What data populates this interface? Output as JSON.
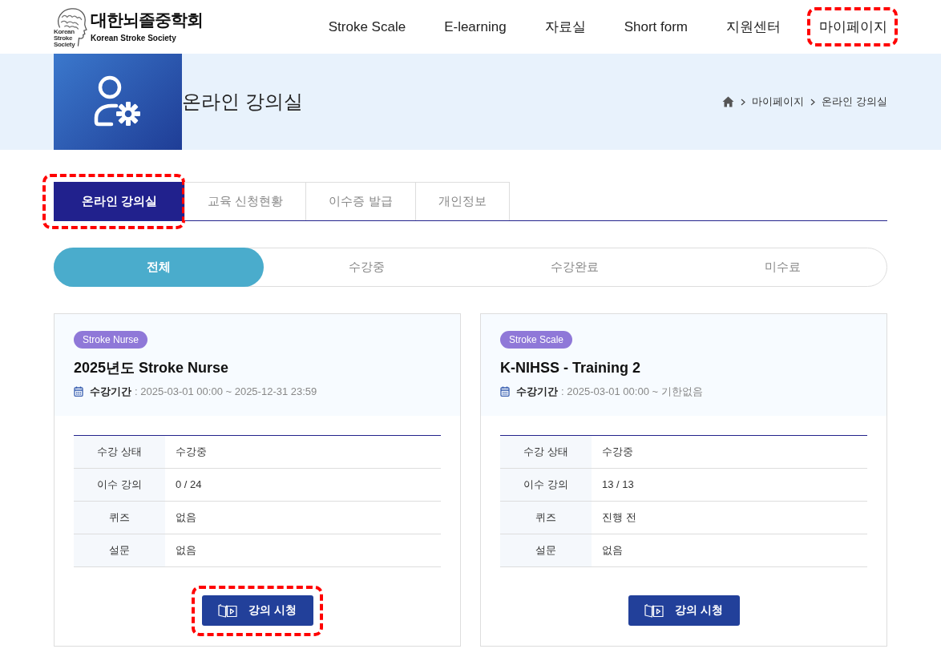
{
  "header": {
    "logo": {
      "name_ko": "대한뇌졸중학회",
      "name_en": "Korean Stroke Society",
      "emblem_lines": [
        "Korean",
        "Stroke",
        "Society"
      ]
    },
    "nav": [
      {
        "label": "Stroke Scale",
        "highlighted": false
      },
      {
        "label": "E-learning",
        "highlighted": false
      },
      {
        "label": "자료실",
        "highlighted": false
      },
      {
        "label": "Short form",
        "highlighted": false
      },
      {
        "label": "지원센터",
        "highlighted": false
      },
      {
        "label": "마이페이지",
        "highlighted": true
      }
    ]
  },
  "banner": {
    "title": "온라인 강의실",
    "breadcrumb": [
      "마이페이지",
      "온라인 강의실"
    ]
  },
  "tabs": [
    {
      "label": "온라인 강의실",
      "selected": true,
      "highlighted": true
    },
    {
      "label": "교육 신청현황",
      "selected": false,
      "highlighted": false
    },
    {
      "label": "이수증 발급",
      "selected": false,
      "highlighted": false
    },
    {
      "label": "개인정보",
      "selected": false,
      "highlighted": false
    }
  ],
  "filters": [
    {
      "label": "전체",
      "selected": true
    },
    {
      "label": "수강중",
      "selected": false
    },
    {
      "label": "수강완료",
      "selected": false
    },
    {
      "label": "미수료",
      "selected": false
    }
  ],
  "courses": [
    {
      "tag": "Stroke Nurse",
      "title": "2025년도 Stroke Nurse",
      "period_label": "수강기간",
      "period": ": 2025-03-01 00:00 ~ 2025-12-31 23:59",
      "rows": [
        {
          "label": "수강 상태",
          "value": "수강중"
        },
        {
          "label": "이수 강의",
          "value": "0 / 24"
        },
        {
          "label": "퀴즈",
          "value": "없음"
        },
        {
          "label": "설문",
          "value": "없음"
        }
      ],
      "button": {
        "label": "강의 시청",
        "highlighted": true
      }
    },
    {
      "tag": "Stroke Scale",
      "title": "K-NIHSS - Training 2",
      "period_label": "수강기간",
      "period": ": 2025-03-01 00:00 ~ 기한없음",
      "rows": [
        {
          "label": "수강 상태",
          "value": "수강중"
        },
        {
          "label": "이수 강의",
          "value": "13 / 13"
        },
        {
          "label": "퀴즈",
          "value": "진행 전"
        },
        {
          "label": "설문",
          "value": "없음"
        }
      ],
      "button": {
        "label": "강의 시청",
        "highlighted": false
      }
    }
  ]
}
